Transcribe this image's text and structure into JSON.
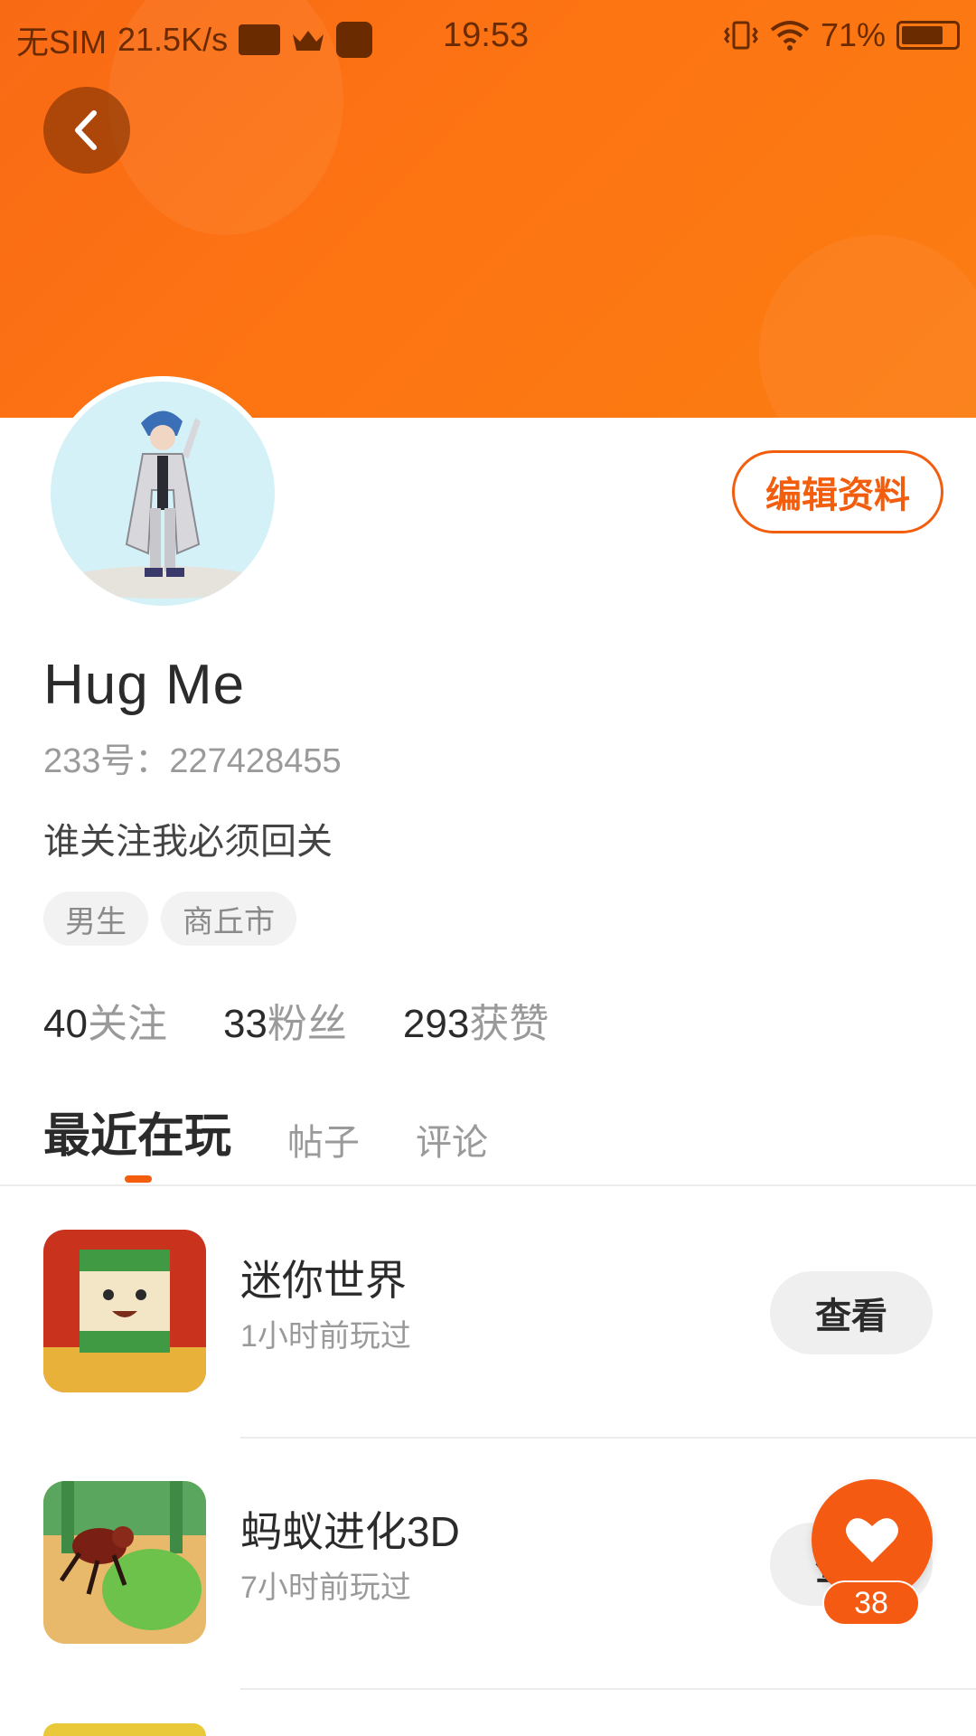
{
  "status_bar": {
    "carrier": "无SIM",
    "speed": "21.5K/s",
    "time": "19:53",
    "battery": "71%"
  },
  "colors": {
    "accent": "#f25d0e",
    "banner": "#fd7413"
  },
  "profile": {
    "name": "Hug  Me",
    "uid": "233号：227428455",
    "bio": "谁关注我必须回关",
    "edit_label": "编辑资料",
    "tags": [
      "男生",
      "商丘市"
    ]
  },
  "stats": [
    {
      "num": "40",
      "label": "关注"
    },
    {
      "num": "33",
      "label": "粉丝"
    },
    {
      "num": "293",
      "label": "获赞"
    }
  ],
  "tabs": [
    {
      "label": "最近在玩",
      "active": true
    },
    {
      "label": "帖子",
      "active": false
    },
    {
      "label": "评论",
      "active": false
    }
  ],
  "games": [
    {
      "title": "迷你世界",
      "subtitle": "1小时前玩过",
      "button": "查看"
    },
    {
      "title": "蚂蚁进化3D",
      "subtitle": "7小时前玩过",
      "button": "查看"
    }
  ],
  "fab": {
    "count": "38",
    "icon": "heart-icon"
  }
}
